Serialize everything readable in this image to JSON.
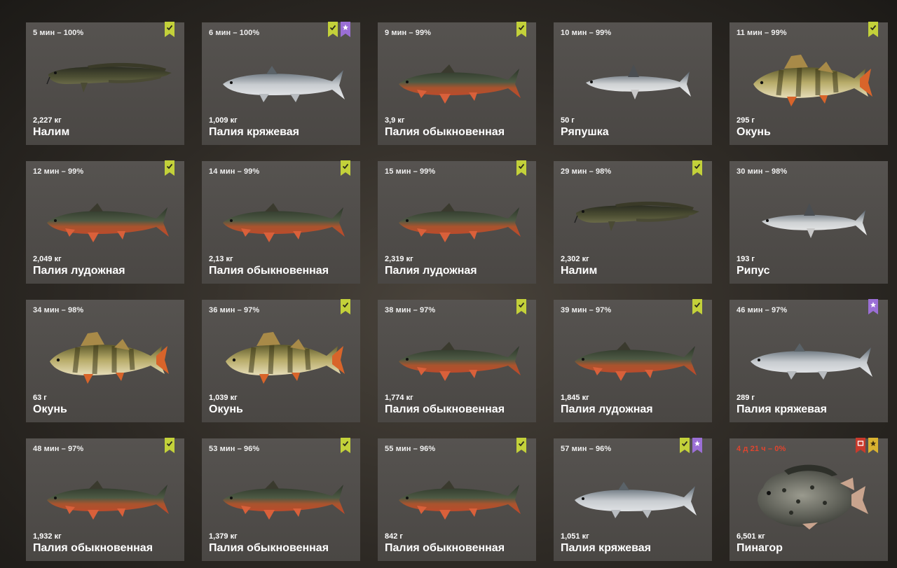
{
  "colors": {
    "card_bg": "#4f4c49",
    "check_badge": "#c3d13a",
    "star_badge": "#9b6fd6",
    "alert_badge": "#c93a2c",
    "gold_star_badge": "#d9b230",
    "alert_text": "#e0442e"
  },
  "cards": [
    {
      "time": "5 мин – 100%",
      "weight": "2,227 кг",
      "name": "Налим",
      "fish": "burbot",
      "badges": [
        "check"
      ]
    },
    {
      "time": "6 мин – 100%",
      "weight": "1,009 кг",
      "name": "Палия кряжевая",
      "fish": "silver",
      "badges": [
        "check",
        "star"
      ]
    },
    {
      "time": "9 мин – 99%",
      "weight": "3,9 кг",
      "name": "Палия обыкновенная",
      "fish": "char",
      "badges": [
        "check"
      ]
    },
    {
      "time": "10 мин – 99%",
      "weight": "50 г",
      "name": "Ряпушка",
      "fish": "vendace",
      "badges": []
    },
    {
      "time": "11 мин – 99%",
      "weight": "295 г",
      "name": "Окунь",
      "fish": "perch",
      "badges": [
        "check"
      ]
    },
    {
      "time": "12 мин – 99%",
      "weight": "2,049 кг",
      "name": "Палия лудожная",
      "fish": "char",
      "badges": [
        "check"
      ]
    },
    {
      "time": "14 мин – 99%",
      "weight": "2,13 кг",
      "name": "Палия обыкновенная",
      "fish": "char",
      "badges": [
        "check"
      ]
    },
    {
      "time": "15 мин – 99%",
      "weight": "2,319 кг",
      "name": "Палия лудожная",
      "fish": "char",
      "badges": [
        "check"
      ]
    },
    {
      "time": "29 мин – 98%",
      "weight": "2,302 кг",
      "name": "Налим",
      "fish": "burbot",
      "badges": [
        "check"
      ]
    },
    {
      "time": "30 мин – 98%",
      "weight": "193 г",
      "name": "Рипус",
      "fish": "vendace",
      "badges": []
    },
    {
      "time": "34 мин – 98%",
      "weight": "63 г",
      "name": "Окунь",
      "fish": "perch",
      "badges": []
    },
    {
      "time": "36 мин – 97%",
      "weight": "1,039 кг",
      "name": "Окунь",
      "fish": "perch",
      "badges": [
        "check"
      ]
    },
    {
      "time": "38 мин – 97%",
      "weight": "1,774 кг",
      "name": "Палия обыкновенная",
      "fish": "char",
      "badges": [
        "check"
      ]
    },
    {
      "time": "39 мин – 97%",
      "weight": "1,845 кг",
      "name": "Палия лудожная",
      "fish": "char",
      "badges": [
        "check"
      ]
    },
    {
      "time": "46 мин – 97%",
      "weight": "289 г",
      "name": "Палия кряжевая",
      "fish": "silver",
      "badges": [
        "star"
      ]
    },
    {
      "time": "48 мин – 97%",
      "weight": "1,932 кг",
      "name": "Палия обыкновенная",
      "fish": "char",
      "badges": [
        "check"
      ]
    },
    {
      "time": "53 мин – 96%",
      "weight": "1,379 кг",
      "name": "Палия обыкновенная",
      "fish": "char",
      "badges": [
        "check"
      ]
    },
    {
      "time": "55 мин – 96%",
      "weight": "842 г",
      "name": "Палия обыкновенная",
      "fish": "char",
      "badges": [
        "check"
      ]
    },
    {
      "time": "57 мин – 96%",
      "weight": "1,051 кг",
      "name": "Палия кряжевая",
      "fish": "silver",
      "badges": [
        "check",
        "star"
      ]
    },
    {
      "time": "4 д 21 ч – 0%",
      "weight": "6,501 кг",
      "name": "Пинагор",
      "fish": "lumpsucker",
      "badges": [
        "alert",
        "goldstar"
      ],
      "alert": true
    }
  ]
}
